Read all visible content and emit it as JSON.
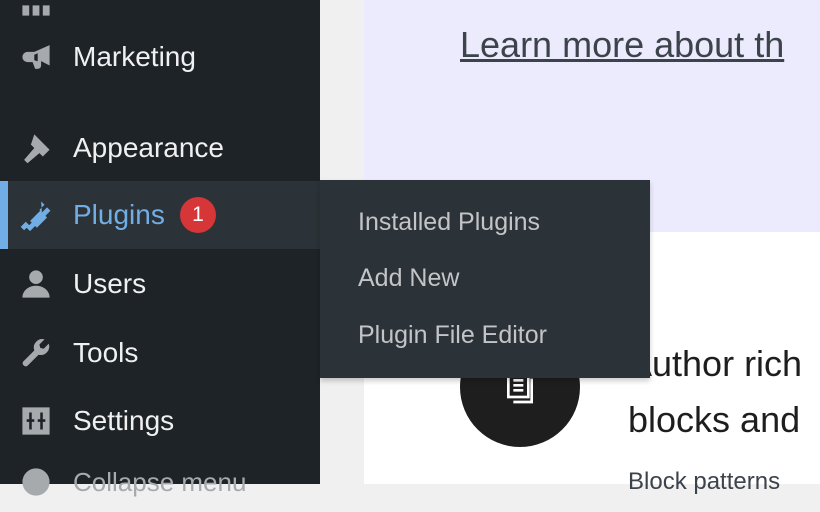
{
  "sidebar": {
    "items": [
      {
        "id": "top-partial",
        "label": "",
        "icon": "grid-icon"
      },
      {
        "id": "marketing",
        "label": "Marketing",
        "icon": "megaphone-icon"
      },
      {
        "id": "appearance",
        "label": "Appearance",
        "icon": "paintbrush-icon"
      },
      {
        "id": "plugins",
        "label": "Plugins",
        "icon": "plugin-icon",
        "badge": "1"
      },
      {
        "id": "users",
        "label": "Users",
        "icon": "user-icon"
      },
      {
        "id": "tools",
        "label": "Tools",
        "icon": "wrench-icon"
      },
      {
        "id": "settings",
        "label": "Settings",
        "icon": "sliders-icon"
      },
      {
        "id": "collapse",
        "label": "Collapse menu",
        "icon": "collapse-arrow-icon"
      }
    ]
  },
  "flyout": {
    "items": [
      {
        "label": "Installed Plugins"
      },
      {
        "label": "Add New"
      },
      {
        "label": "Plugin File Editor"
      }
    ]
  },
  "content": {
    "learn_link": "Learn more about th",
    "feature": {
      "title_line1": "Author rich",
      "title_line2": "blocks and",
      "description": "Block patterns",
      "icon": "pattern-icon"
    }
  },
  "colors": {
    "sidebar_bg": "#1d2327",
    "flyout_bg": "#2c3338",
    "accent": "#72aee6",
    "badge": "#d63638",
    "banner_bg": "#ebebfd"
  }
}
